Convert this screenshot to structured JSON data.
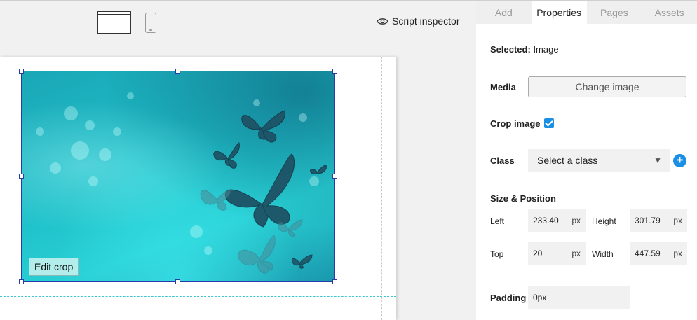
{
  "toolbar": {
    "desktop_view": "desktop-view-icon",
    "mobile_view": "mobile-view-icon",
    "script_inspector_label": "Script inspector"
  },
  "canvas": {
    "edit_crop_label": "Edit crop"
  },
  "panel": {
    "tabs": [
      {
        "label": "Add",
        "active": false
      },
      {
        "label": "Properties",
        "active": true
      },
      {
        "label": "Pages",
        "active": false
      },
      {
        "label": "Assets",
        "active": false
      }
    ],
    "selected_label": "Selected:",
    "selected_value": "Image",
    "media_label": "Media",
    "change_image_label": "Change image",
    "crop_image_label": "Crop image",
    "crop_image_checked": true,
    "class_label": "Class",
    "class_select_value": "Select a class",
    "size_position_label": "Size & Position",
    "left_label": "Left",
    "left_value": "233.40",
    "left_unit": "px",
    "height_label": "Height",
    "height_value": "301.79",
    "height_unit": "px",
    "top_label": "Top",
    "top_value": "20",
    "top_unit": "px",
    "width_label": "Width",
    "width_value": "447.59",
    "width_unit": "px",
    "padding_label": "Padding",
    "padding_value": "0px"
  },
  "colors": {
    "accent": "#1a8fe3",
    "selection": "#2a3aa8",
    "guide": "#3cc6d2"
  }
}
